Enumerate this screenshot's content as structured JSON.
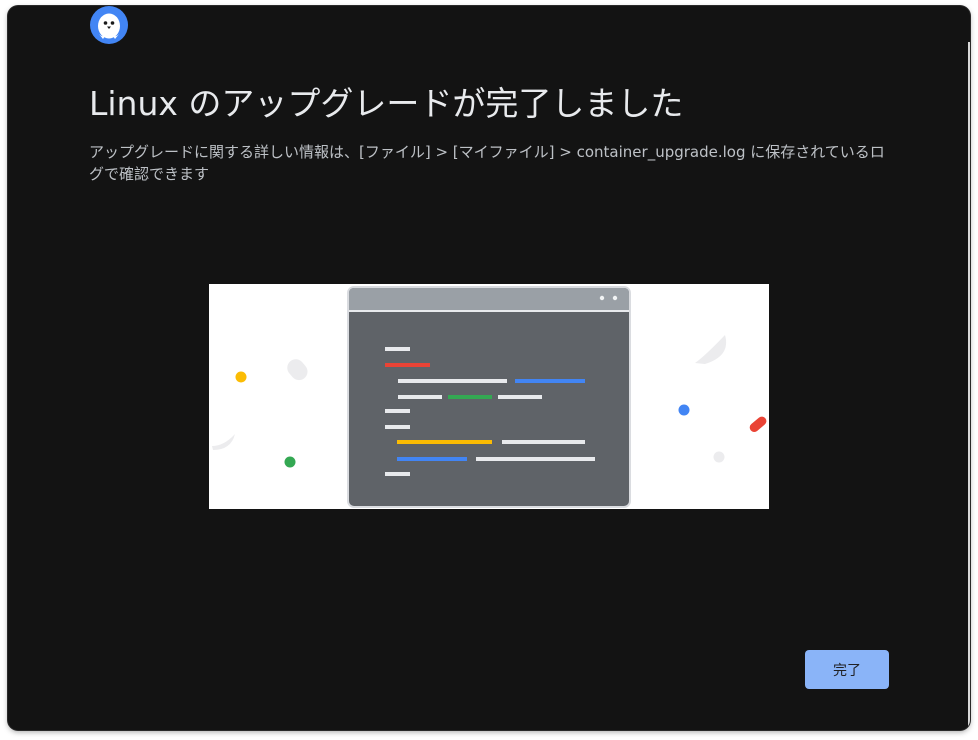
{
  "dialog": {
    "title": "Linux のアップグレードが完了しました",
    "description": "アップグレードに関する詳しい情報は、[ファイル] > [マイファイル] > container_upgrade.log に保存されているログで確認できます",
    "done_label": "完了"
  },
  "icons": {
    "app_logo": "penguin-icon"
  },
  "colors": {
    "background": "#131313",
    "accent": "#8ab4f8",
    "title_text": "#e8eaed",
    "body_text": "#bdc1c6",
    "google_blue": "#4285f4",
    "google_red": "#ea4335",
    "google_yellow": "#fbbc04",
    "google_green": "#34a853"
  }
}
